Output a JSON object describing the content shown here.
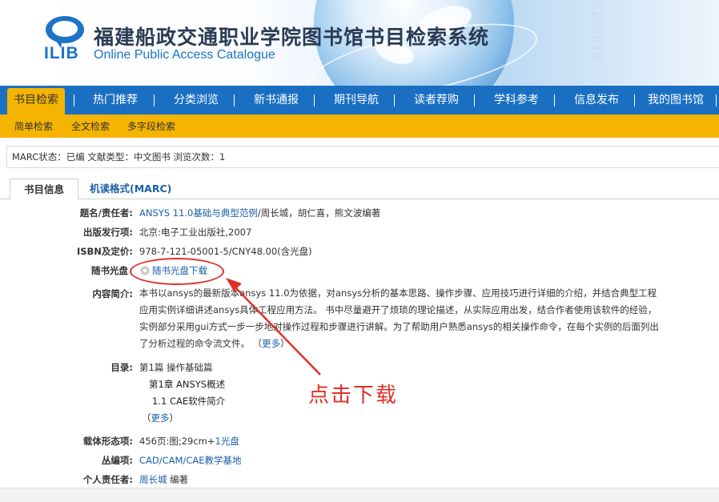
{
  "header": {
    "logo_text": "ILIB",
    "title": "福建船政交通职业学院图书馆书目检索系统",
    "subtitle": "Online Public Access Catalogue",
    "bits_left": "10101",
    "bits_right": "0100010"
  },
  "nav": {
    "items": [
      "书目检索",
      "热门推荐",
      "分类浏览",
      "新书通报",
      "期刊导航",
      "读者荐购",
      "学科参考",
      "信息发布",
      "我的图书馆"
    ],
    "active_index": 0
  },
  "subnav": {
    "items": [
      "简单检索",
      "全文检索",
      "多字段检索"
    ]
  },
  "status": {
    "text": "MARC状态：已编    文献类型：中文图书    浏览次数：1"
  },
  "tabs": {
    "items": [
      "书目信息",
      "机读格式(MARC)"
    ]
  },
  "record": {
    "title_label": "题名/责任者:",
    "title_link": "ANSYS 11.0基础与典型范例",
    "title_rest": "/周长城，胡仁喜，熊文波编著",
    "publish_label": "出版发行项:",
    "publish_value": "北京:电子工业出版社,2007",
    "isbn_label": "ISBN及定价:",
    "isbn_value": "978-7-121-05001-5/CNY48.00(含光盘)",
    "cd_label": "随书光盘",
    "cd_link": "随书光盘下载",
    "summary_label": "内容简介:",
    "summary_text": "本书以ansys的最新版本ansys 11.0为依据，对ansys分析的基本思路、操作步骤、应用技巧进行详细的介绍，并结合典型工程应用实例详细讲述ansys具体工程应用方法。 书中尽量避开了烦琐的理论描述，从实际应用出发，结合作者使用该软件的经验，实例部分采用gui方式一步一步地对操作过程和步骤进行讲解。为了帮助用户熟悉ansys的相关操作命令，在每个实例的后面列出了分析过程的命令流文件。 （",
    "summary_more": "更多",
    "summary_close": "）",
    "toc_label": "目录:",
    "toc_lines": [
      "第1篇    操作基础篇",
      "第1章    ANSYS概述",
      "1.1    CAE软件简介"
    ],
    "toc_more_open": "（",
    "toc_more": "更多",
    "toc_more_close": "）",
    "physical_label": "载体形态项:",
    "physical_value": "456页:图;29cm+",
    "physical_link": "1光盘",
    "series_label": "丛编项:",
    "series_link": "CAD/CAM/CAE教学基地",
    "author_label": "个人责任者:",
    "author_link": "周长城",
    "author_rest": " 编著"
  },
  "annotation": {
    "text": "点击下载",
    "color": "#e0302a"
  }
}
